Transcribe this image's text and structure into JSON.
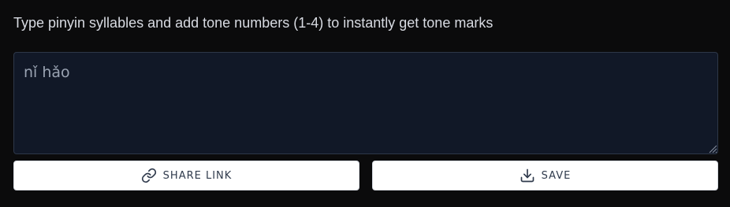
{
  "instructions": "Type pinyin syllables and add tone numbers (1-4) to instantly get tone marks",
  "editor": {
    "placeholder": "nǐ hǎo",
    "value": ""
  },
  "buttons": {
    "share": {
      "label": "SHARE LINK",
      "icon": "link-icon"
    },
    "save": {
      "label": "SAVE",
      "icon": "download-icon"
    }
  },
  "colors": {
    "background": "#0b0b0c",
    "editor_background": "#111827",
    "editor_border": "#2d3748",
    "placeholder_text": "#9aa3b2",
    "button_background": "#ffffff",
    "button_text": "#2f3a4c"
  }
}
